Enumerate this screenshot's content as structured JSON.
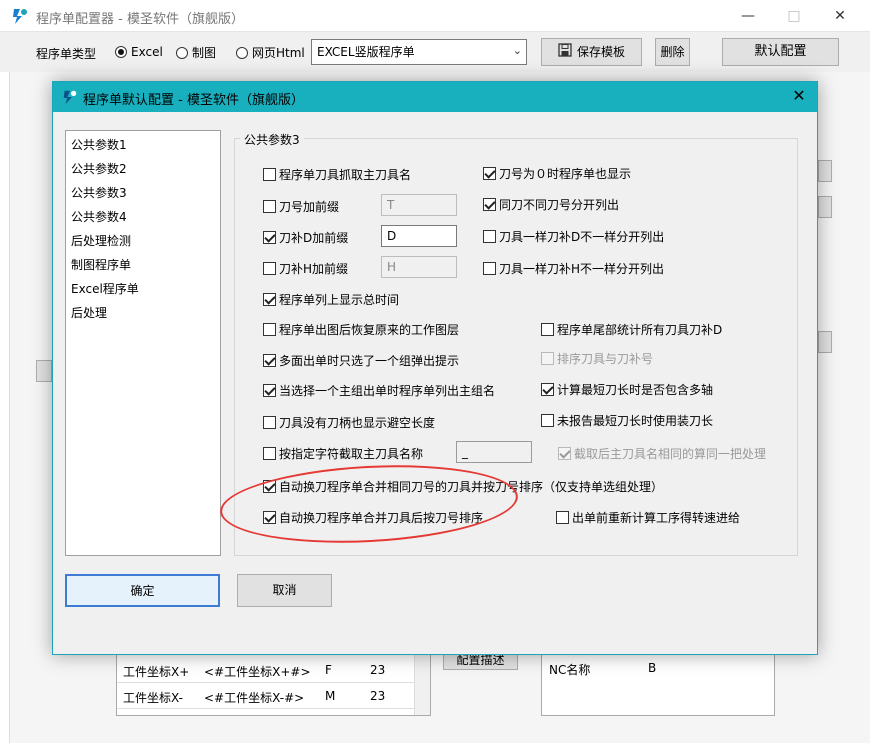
{
  "main_window": {
    "title": "程序单配置器 - 模圣软件（旗舰版）",
    "brand_color": "#1a7fd4",
    "program_type_label": "程序单类型",
    "radio_options": [
      {
        "label": "Excel",
        "selected": true
      },
      {
        "label": "制图",
        "selected": false
      },
      {
        "label": "网页Html",
        "selected": false
      }
    ],
    "template_combo_value": "EXCEL竖版程序单",
    "save_template_button": "保存模板",
    "delete_button": "删除",
    "default_config_button": "默认配置",
    "config_desc_button": "配置描述",
    "bg_table_rows": [
      {
        "name": "工件坐标X+",
        "code": "<#工件坐标X+#>",
        "flag": "F",
        "num": "23"
      },
      {
        "name": "工件坐标X-",
        "code": "<#工件坐标X-#>",
        "flag": "M",
        "num": "23"
      }
    ],
    "nc_row": {
      "label": "NC名称",
      "value": "B"
    }
  },
  "dialog": {
    "title": "程序单默认配置 - 模圣软件（旗舰版）",
    "titlebar_color": "#18b0bf",
    "nav_items": [
      "公共参数1",
      "公共参数2",
      "公共参数3",
      "公共参数4",
      "后处理检测",
      "制图程序单",
      "Excel程序单",
      "后处理"
    ],
    "group_title": "公共参数3",
    "options": {
      "tool_name_from_main": {
        "label": "程序单刀具抓取主刀具名",
        "checked": false
      },
      "tool_num_zero_show": {
        "label": "刀号为０时程序单也显示",
        "checked": true
      },
      "tool_num_prefix": {
        "label": "刀号加前缀",
        "checked": false,
        "value": "T"
      },
      "same_tool_diff_num_split": {
        "label": "同刀不同刀号分开列出",
        "checked": true
      },
      "tool_d_prefix": {
        "label": "刀补D加前缀",
        "checked": true,
        "value": "D"
      },
      "same_tool_diff_d_split": {
        "label": "刀具一样刀补D不一样分开列出",
        "checked": false
      },
      "tool_h_prefix": {
        "label": "刀补H加前缀",
        "checked": false,
        "value": "H"
      },
      "same_tool_diff_h_split": {
        "label": "刀具一样刀补H不一样分开列出",
        "checked": false
      },
      "show_total_time": {
        "label": "程序单列上显示总时间",
        "checked": true
      },
      "restore_layer": {
        "label": "程序单出图后恢复原来的工作图层",
        "checked": false
      },
      "tail_stats_tool_d": {
        "label": "程序单尾部统计所有刀具刀补D",
        "checked": false
      },
      "multi_face_prompt": {
        "label": "多面出单时只选了一个组弹出提示",
        "checked": true
      },
      "sort_tool_and_d": {
        "label": "排序刀具与刀补号",
        "checked": false
      },
      "single_main_group": {
        "label": "当选择一个主组出单时程序单列出主组名",
        "checked": true
      },
      "shortest_tool_multi_axis": {
        "label": "计算最短刀长时是否包含多轴",
        "checked": true
      },
      "no_holder_clearance": {
        "label": "刀具没有刀柄也显示避空长度",
        "checked": false
      },
      "no_shortest_use_install": {
        "label": "未报告最短刀长时使用装刀长",
        "checked": false
      },
      "truncate_by_char": {
        "label": "按指定字符截取主刀具名称",
        "checked": false,
        "value": "_"
      },
      "truncate_same_name": {
        "label": "截取后主刀具名相同的算同一把处理",
        "checked": true
      },
      "merge_same_tool_sort": {
        "label": "自动换刀程序单合并相同刀号的刀具并按刀号排序（仅支持单选组处理）",
        "checked": true
      },
      "merge_sort_after": {
        "label": "自动换刀程序单合并刀具后按刀号排序",
        "checked": true
      },
      "recalc_spindle_feed": {
        "label": "出单前重新计算工序得转速进给",
        "checked": false
      }
    },
    "ok_button": "确定",
    "cancel_button": "取消",
    "annotation_color": "#e53935"
  }
}
